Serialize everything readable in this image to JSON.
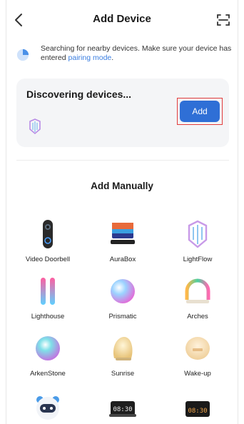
{
  "header": {
    "title": "Add Device"
  },
  "search": {
    "text": "Searching for nearby devices. Make sure your device has entered",
    "link": "pairing mode",
    "suffix": "."
  },
  "discover": {
    "title": "Discovering devices...",
    "add_label": "Add"
  },
  "manual": {
    "title": "Add Manually",
    "devices": [
      {
        "label": "Video Doorbell",
        "icon": "video-doorbell-icon"
      },
      {
        "label": "AuraBox",
        "icon": "aurabox-icon"
      },
      {
        "label": "LightFlow",
        "icon": "lightflow-icon"
      },
      {
        "label": "Lighthouse",
        "icon": "lighthouse-icon"
      },
      {
        "label": "Prismatic",
        "icon": "prismatic-icon"
      },
      {
        "label": "Arches",
        "icon": "arches-icon"
      },
      {
        "label": "ArkenStone",
        "icon": "arkenstone-icon"
      },
      {
        "label": "Sunrise",
        "icon": "sunrise-icon"
      },
      {
        "label": "Wake-up",
        "icon": "wake-up-icon"
      },
      {
        "label": "",
        "icon": "robot-light-icon"
      },
      {
        "label": "08:30",
        "icon": "alarm-clock-icon"
      },
      {
        "label": "08:30",
        "icon": "clock-display-icon"
      }
    ]
  },
  "colors": {
    "accent": "#2f6fd6",
    "highlight": "#e23b3b",
    "link": "#3a7ee0"
  }
}
